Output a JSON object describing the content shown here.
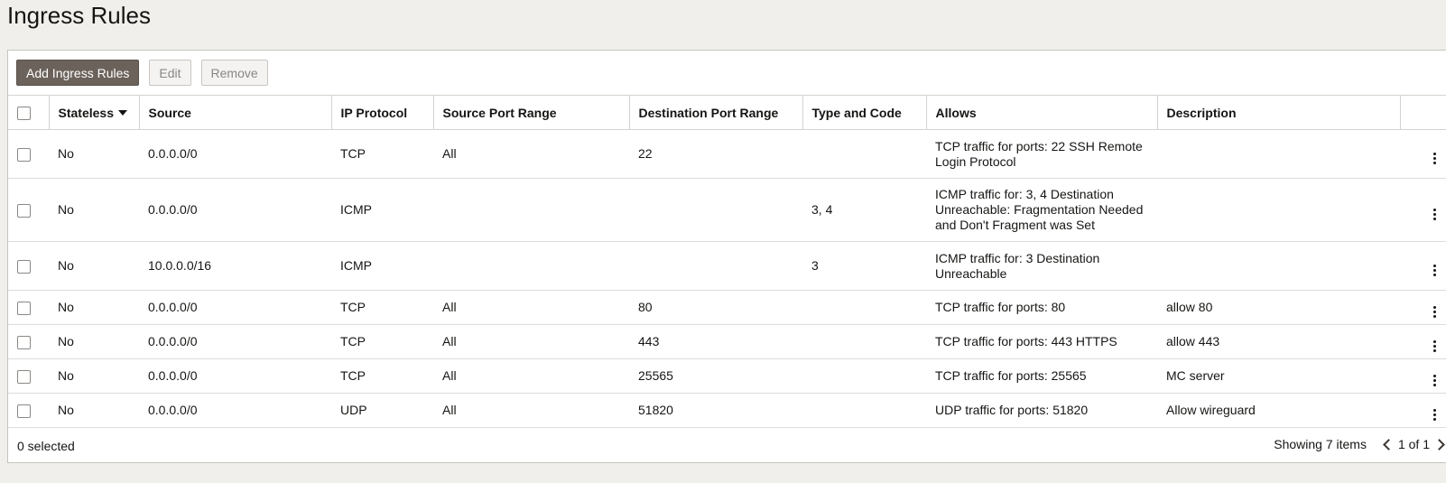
{
  "page": {
    "title": "Ingress Rules"
  },
  "toolbar": {
    "add_label": "Add Ingress Rules",
    "edit_label": "Edit",
    "remove_label": "Remove"
  },
  "table": {
    "columns": [
      "Stateless",
      "Source",
      "IP Protocol",
      "Source Port Range",
      "Destination Port Range",
      "Type and Code",
      "Allows",
      "Description"
    ],
    "rows": [
      {
        "stateless": "No",
        "source": "0.0.0.0/0",
        "protocol": "TCP",
        "src_port": "All",
        "dst_port": "22",
        "type_code": "",
        "allows": "TCP traffic for ports: 22 SSH Remote Login Protocol",
        "description": ""
      },
      {
        "stateless": "No",
        "source": "0.0.0.0/0",
        "protocol": "ICMP",
        "src_port": "",
        "dst_port": "",
        "type_code": "3, 4",
        "allows": "ICMP traffic for: 3, 4 Destination Unreachable: Fragmentation Needed and Don't Fragment was Set",
        "description": ""
      },
      {
        "stateless": "No",
        "source": "10.0.0.0/16",
        "protocol": "ICMP",
        "src_port": "",
        "dst_port": "",
        "type_code": "3",
        "allows": "ICMP traffic for: 3 Destination Unreachable",
        "description": ""
      },
      {
        "stateless": "No",
        "source": "0.0.0.0/0",
        "protocol": "TCP",
        "src_port": "All",
        "dst_port": "80",
        "type_code": "",
        "allows": "TCP traffic for ports: 80",
        "description": "allow 80"
      },
      {
        "stateless": "No",
        "source": "0.0.0.0/0",
        "protocol": "TCP",
        "src_port": "All",
        "dst_port": "443",
        "type_code": "",
        "allows": "TCP traffic for ports: 443 HTTPS",
        "description": "allow 443"
      },
      {
        "stateless": "No",
        "source": "0.0.0.0/0",
        "protocol": "TCP",
        "src_port": "All",
        "dst_port": "25565",
        "type_code": "",
        "allows": "TCP traffic for ports: 25565",
        "description": "MC server"
      },
      {
        "stateless": "No",
        "source": "0.0.0.0/0",
        "protocol": "UDP",
        "src_port": "All",
        "dst_port": "51820",
        "type_code": "",
        "allows": "UDP traffic for ports: 51820",
        "description": "Allow wireguard"
      }
    ]
  },
  "footer": {
    "selected_text": "0 selected",
    "showing_text": "Showing 7 items",
    "page_text": "1 of 1"
  },
  "colors": {
    "primary_button": "#6b625b",
    "background": "#f1efec"
  }
}
